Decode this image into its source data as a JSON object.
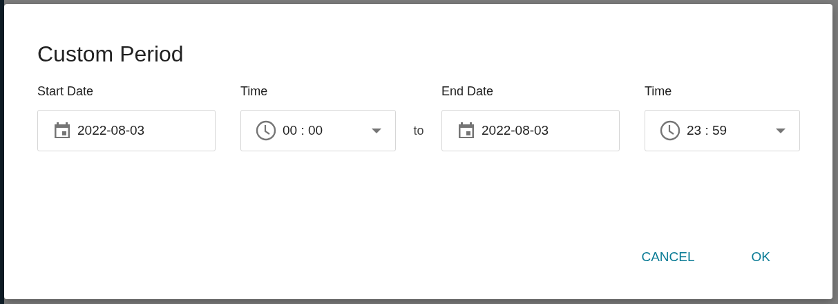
{
  "dialog": {
    "title": "Custom Period",
    "fields": [
      {
        "kind": "date",
        "label": "Start Date",
        "value": "2022-08-03"
      },
      {
        "kind": "time",
        "label": "Time",
        "value": "00 : 00"
      },
      {
        "kind": "separator",
        "text": "to"
      },
      {
        "kind": "date",
        "label": "End Date",
        "value": "2022-08-03"
      },
      {
        "kind": "time",
        "label": "Time",
        "value": "23 : 59"
      }
    ],
    "buttons": [
      "CANCEL",
      "OK"
    ]
  }
}
